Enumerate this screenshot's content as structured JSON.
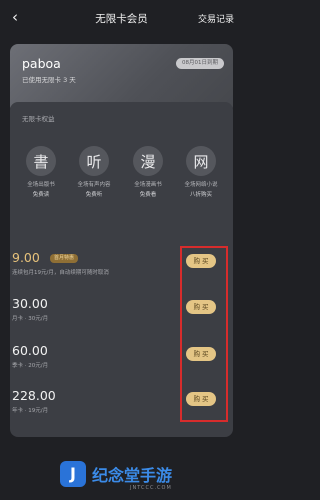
{
  "nav": {
    "back_icon": "chevron-left-icon",
    "back_glyph": "‹",
    "title": "无限卡会员",
    "right_link": "交易记录"
  },
  "user": {
    "name": "paboa",
    "subtitle": "已使用无限卡 3 天",
    "badge": "08月01日到期"
  },
  "benefits": {
    "title": "无限卡权益",
    "items": [
      {
        "glyph": "書",
        "icon": "book-icon",
        "line1": "全场出版书",
        "line2": "免费读"
      },
      {
        "glyph": "听",
        "icon": "listen-icon",
        "line1": "全场有声内容",
        "line2": "免费听"
      },
      {
        "glyph": "漫",
        "icon": "comic-icon",
        "line1": "全场漫画书",
        "line2": "免费看"
      },
      {
        "glyph": "网",
        "icon": "web-novel-icon",
        "line1": "全场网络小说",
        "line2": "八折购买"
      }
    ]
  },
  "plans": [
    {
      "price": "9.00",
      "tag": "首月特惠",
      "desc": "连续包月19元/月，自动续期可随时取消",
      "button": "购 买"
    },
    {
      "price": "30.00",
      "tag": "",
      "desc": "月卡 · 30元/月",
      "button": "购 买"
    },
    {
      "price": "60.00",
      "tag": "",
      "desc": "季卡 · 20元/月",
      "button": "购 买"
    },
    {
      "price": "228.00",
      "tag": "",
      "desc": "年卡 · 19元/月",
      "button": "购 买"
    }
  ],
  "watermark": {
    "icon_letter": "J",
    "text": "纪念堂手游",
    "url": "JNTCCC.COM"
  },
  "colors": {
    "background": "#1f2024",
    "panel": "#3c3e44",
    "accent_gold": "#e4c585",
    "highlight_red": "#d72c2c"
  }
}
